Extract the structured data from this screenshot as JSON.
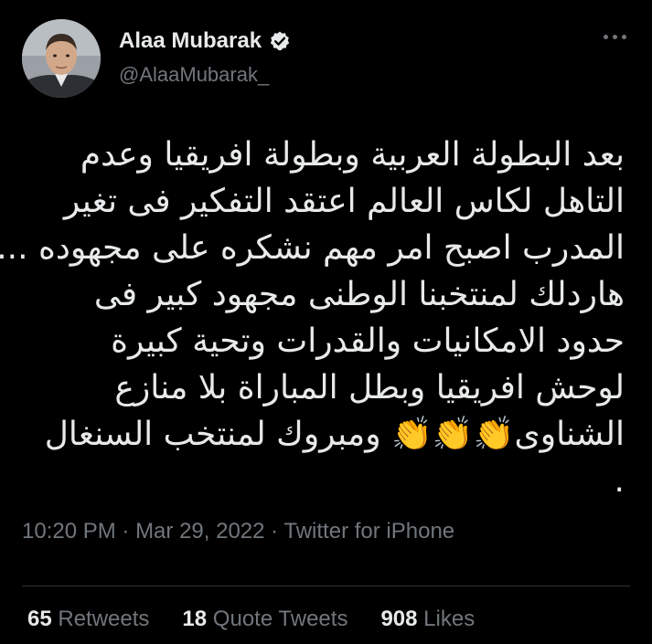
{
  "author": {
    "display_name": "Alaa Mubarak",
    "handle": "@AlaaMubarak_",
    "verified": true
  },
  "menu": {
    "icon": "more-horizontal-icon"
  },
  "tweet": {
    "lines": [
      "بعد البطولة العربية وبطولة افريقيا وعدم",
      "التاهل لكاس العالم اعتقد التفكير فى تغير",
      "المدرب اصبح امر مهم نشكره على مجهوده ...",
      "هاردلك لمنتخبنا الوطنى مجهود كبير فى",
      "حدود الامكانيات والقدرات وتحية كبيرة",
      "لوحش افريقيا وبطل المباراة بلا منازع",
      "الشناوى👏👏👏 ومبروك لمنتخب السنغال",
      "."
    ]
  },
  "meta": {
    "time": "10:20 PM",
    "separator": " · ",
    "date": "Mar 29, 2022",
    "source": "Twitter for iPhone"
  },
  "stats": {
    "retweets_count": "65",
    "retweets_label": "Retweets",
    "quotes_count": "18",
    "quotes_label": "Quote Tweets",
    "likes_count": "908",
    "likes_label": "Likes"
  },
  "colors": {
    "background": "#000000",
    "primary_text": "#e7e9ea",
    "secondary_text": "#71767b",
    "verified_badge": "#e7e9ea"
  }
}
